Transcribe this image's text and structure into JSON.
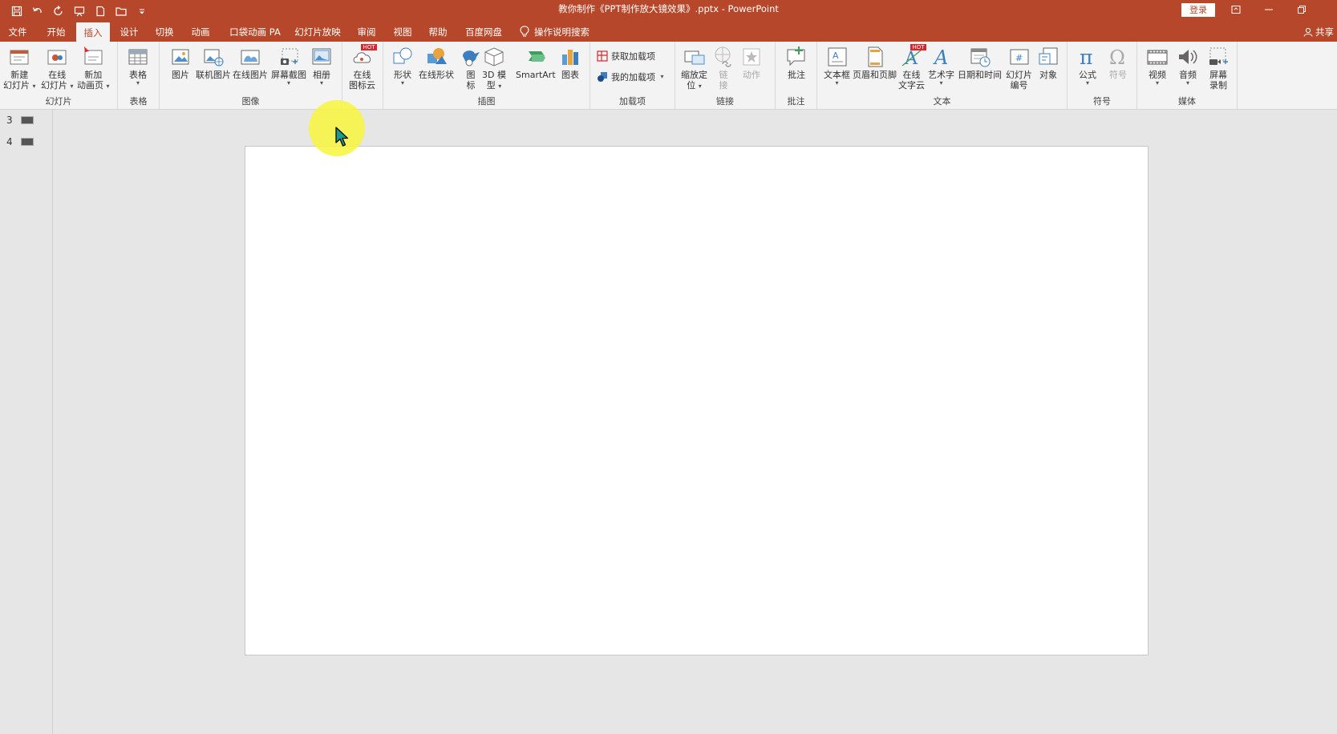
{
  "window": {
    "title": "教你制作《PPT制作放大镜效果》.pptx  -  PowerPoint",
    "login_label": "登录"
  },
  "tabs": [
    {
      "label": "文件"
    },
    {
      "label": "开始"
    },
    {
      "label": "插入",
      "active": true
    },
    {
      "label": "设计"
    },
    {
      "label": "切换"
    },
    {
      "label": "动画"
    },
    {
      "label": "口袋动画 PA"
    },
    {
      "label": "幻灯片放映"
    },
    {
      "label": "审阅"
    },
    {
      "label": "视图"
    },
    {
      "label": "帮助"
    },
    {
      "label": "百度网盘"
    }
  ],
  "tell_me": "操作说明搜索",
  "share": "共享",
  "ribbon": {
    "groups": {
      "slides": "幻灯片",
      "table": "表格",
      "images": "图像",
      "iconcloud": "",
      "illustrations": "插图",
      "addins": "加载项",
      "links": "链接",
      "comments": "批注",
      "text": "文本",
      "symbols": "符号",
      "media": "媒体"
    },
    "buttons": {
      "new_slide": [
        "新建",
        "幻灯片"
      ],
      "online_slide": [
        "在线",
        "幻灯片"
      ],
      "new_anim_page": [
        "新加",
        "动画页"
      ],
      "table": "表格",
      "picture": "图片",
      "online_picture": "联机图片",
      "online_pic2": "在线图片",
      "screenshot": "屏幕截图",
      "album": "相册",
      "online_icon_cloud": [
        "在线",
        "图标云"
      ],
      "shapes": "形状",
      "online_shapes": "在线形状",
      "icons": [
        "图",
        "标"
      ],
      "model3d": [
        "3D 模",
        "型"
      ],
      "smartart": "SmartArt",
      "chart": "图表",
      "get_addins": "获取加载项",
      "my_addins": "我的加载项",
      "zoom": [
        "缩放定",
        "位"
      ],
      "link": [
        "链",
        "接"
      ],
      "action": "动作",
      "comment": "批注",
      "textbox": "文本框",
      "header_footer": "页眉和页脚",
      "online_text_cloud": [
        "在线",
        "文字云"
      ],
      "wordart": "艺术字",
      "datetime": "日期和时间",
      "slide_number": [
        "幻灯片",
        "编号"
      ],
      "object": "对象",
      "equation": "公式",
      "symbol": "符号",
      "video": "视频",
      "audio": "音频",
      "screen_record": [
        "屏幕",
        "录制"
      ]
    },
    "hot_badge": "HOT"
  },
  "thumbnails": [
    {
      "number": "3"
    },
    {
      "number": "4"
    }
  ],
  "colors": {
    "accent": "#b7472a"
  }
}
